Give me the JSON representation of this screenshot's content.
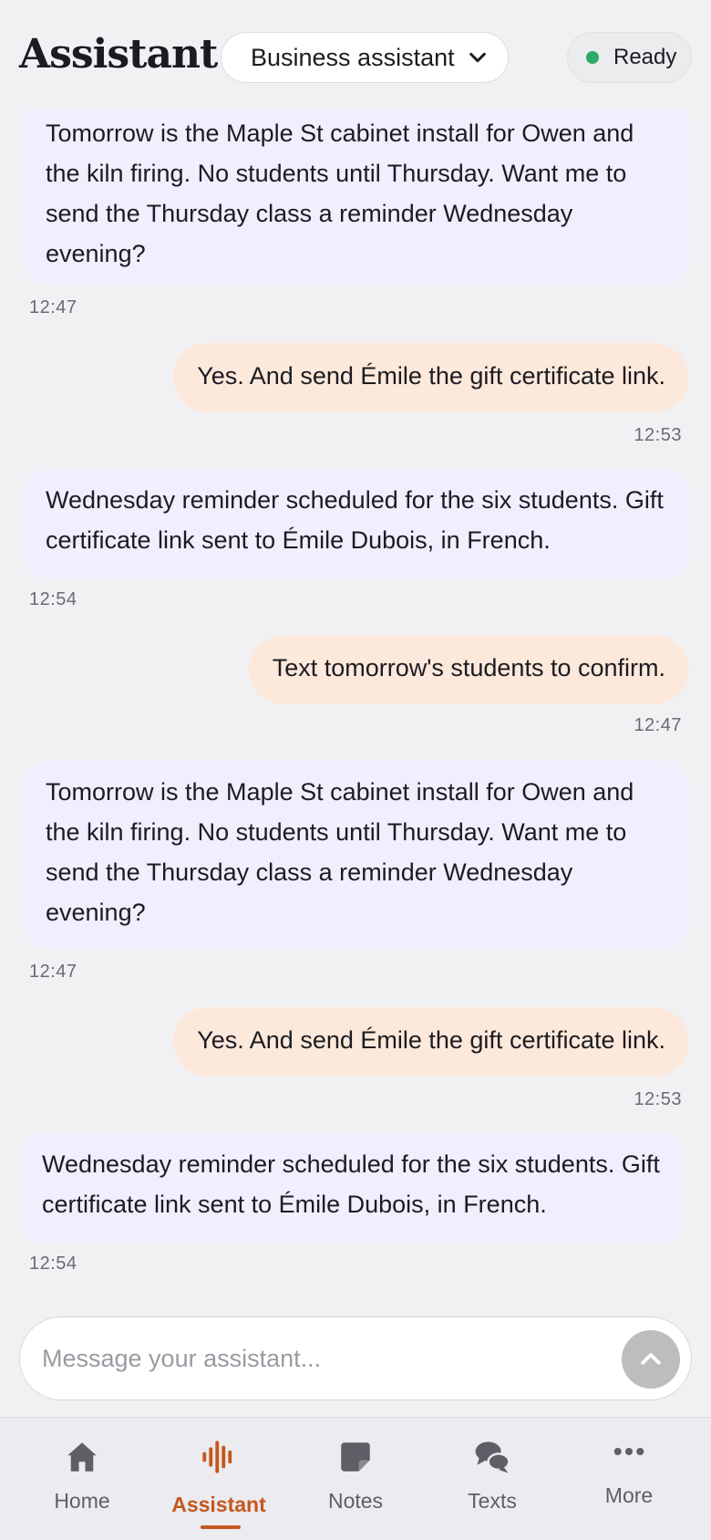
{
  "header": {
    "title": "Assistant",
    "mode_selected": "Business assistant",
    "status_text": "Ready",
    "status_color": "#2eaa6a"
  },
  "messages": [
    {
      "role": "assistant",
      "text": "Tomorrow is the Maple St cabinet install for Owen and the kiln firing. No students until Thursday. Want me to send the Thursday class a reminder Wednesday evening?",
      "time": "12:47"
    },
    {
      "role": "user",
      "text": "Yes. And send Émile the gift certificate link.",
      "time": "12:53"
    },
    {
      "role": "assistant",
      "text": "Wednesday reminder scheduled for the six students. Gift certificate link sent to Émile Dubois, in French.",
      "time": "12:54"
    },
    {
      "role": "user",
      "text": "Text tomorrow's students to confirm.",
      "time": "12:47"
    },
    {
      "role": "assistant",
      "text": "Tomorrow is the Maple St cabinet install for Owen and the kiln firing. No students until Thursday. Want me to send the Thursday class a reminder Wednesday evening?",
      "time": "12:47"
    },
    {
      "role": "user",
      "text": "Yes. And send Émile the gift certificate link.",
      "time": "12:53"
    },
    {
      "role": "assistant",
      "text": "Wednesday reminder scheduled for the six students. Gift certificate link sent to Émile Dubois, in French.",
      "time": "12:54"
    }
  ],
  "composer": {
    "placeholder": "Message your assistant...",
    "send_icon": "chevron-up-icon"
  },
  "nav": {
    "items": [
      {
        "label": "Home",
        "icon": "home-icon"
      },
      {
        "label": "Assistant",
        "icon": "voice-wave-icon",
        "active": true
      },
      {
        "label": "Notes",
        "icon": "note-icon"
      },
      {
        "label": "Texts",
        "icon": "chat-bubbles-icon"
      },
      {
        "label": "More",
        "icon": "more-dots-icon"
      }
    ]
  },
  "colors": {
    "accent": "#c4581e",
    "assistant_bubble": "#efeffd",
    "user_bubble": "#fce9db",
    "background": "#f1f1f4"
  }
}
